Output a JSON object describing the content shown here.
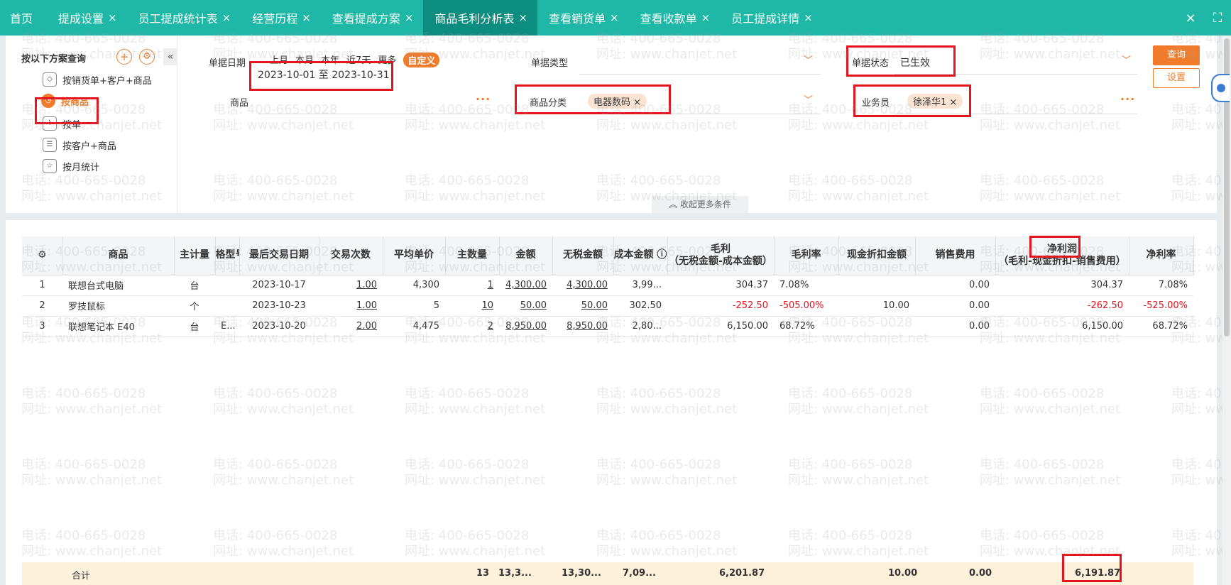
{
  "tabs": [
    {
      "label": "首页",
      "closable": false,
      "active": false
    },
    {
      "label": "提成设置",
      "closable": true,
      "active": false
    },
    {
      "label": "员工提成统计表",
      "closable": true,
      "active": false
    },
    {
      "label": "经营历程",
      "closable": true,
      "active": false
    },
    {
      "label": "查看提成方案",
      "closable": true,
      "active": false
    },
    {
      "label": "商品毛利分析表",
      "closable": true,
      "active": true
    },
    {
      "label": "查看销货单",
      "closable": true,
      "active": false
    },
    {
      "label": "查看收款单",
      "closable": true,
      "active": false
    },
    {
      "label": "员工提成详情",
      "closable": true,
      "active": false
    }
  ],
  "tabbar_icons": {
    "close_all": "×",
    "fullscreen": "⛶"
  },
  "close_glyph": "×",
  "scheme": {
    "title": "按以下方案查询",
    "add": "+",
    "settings": "⚙",
    "collapse": "«",
    "items": [
      {
        "label": "按销货单+客户+商品",
        "icon": "cube-icon",
        "glyph": "◇",
        "active": false
      },
      {
        "label": "按商品",
        "icon": "clock-icon",
        "glyph": "◔",
        "active": true
      },
      {
        "label": "按单",
        "icon": "chart-icon",
        "glyph": "⌇",
        "active": false
      },
      {
        "label": "按客户+商品",
        "icon": "contact-icon",
        "glyph": "☰",
        "active": false
      },
      {
        "label": "按月统计",
        "icon": "calendar-icon",
        "glyph": "☆",
        "active": false
      }
    ]
  },
  "filters": {
    "date_label": "单据日期",
    "quick_ranges": [
      "上月",
      "本月",
      "本年",
      "近7天",
      "更多"
    ],
    "custom_label": "自定义",
    "date_range": "2023-10-01 至 2023-10-31",
    "type_label": "单据类型",
    "status_label": "单据状态",
    "status_value": "已生效",
    "product_label": "商品",
    "category_label": "商品分类",
    "category_tag": "电器数码",
    "salesman_label": "业务员",
    "salesman_tag": "徐泽华1",
    "more_glyph": "···",
    "chevron": "﹀",
    "more_conditions": "收起更多条件"
  },
  "buttons": {
    "query": "查询",
    "settings": "设置"
  },
  "table": {
    "settings_glyph": "⚙",
    "headers": [
      {
        "l1": "",
        "l2": ""
      },
      {
        "l1": "商品",
        "l2": ""
      },
      {
        "l1": "主计量",
        "l2": ""
      },
      {
        "l1": "格型号",
        "l2": ""
      },
      {
        "l1": "最后交易日期",
        "l2": ""
      },
      {
        "l1": "交易次数",
        "l2": ""
      },
      {
        "l1": "平均单价",
        "l2": ""
      },
      {
        "l1": "主数量",
        "l2": ""
      },
      {
        "l1": "金额",
        "l2": ""
      },
      {
        "l1": "无税金额",
        "l2": ""
      },
      {
        "l1": "成本金额 ⓘ",
        "l2": ""
      },
      {
        "l1": "毛利",
        "l2": "（无税金额-成本金额）"
      },
      {
        "l1": "毛利率",
        "l2": ""
      },
      {
        "l1": "现金折扣金额",
        "l2": ""
      },
      {
        "l1": "销售费用",
        "l2": ""
      },
      {
        "l1": "净利润",
        "l2": "（毛利-现金折扣-销售费用）"
      },
      {
        "l1": "净利率",
        "l2": ""
      }
    ],
    "rows": [
      [
        "1",
        "联想台式电脑",
        "台",
        "",
        "2023-10-17",
        "1.00",
        "4,300",
        "1",
        "4,300.00",
        "4,300.00",
        "3,99...",
        "304.37",
        "7.08%",
        "",
        "0.00",
        "304.37",
        "7.08%"
      ],
      [
        "2",
        "罗技鼠标",
        "个",
        "",
        "2023-10-23",
        "1.00",
        "5",
        "10",
        "50.00",
        "50.00",
        "302.50",
        "-252.50",
        "-505.00%",
        "10.00",
        "0.00",
        "-262.50",
        "-525.00%"
      ],
      [
        "3",
        "联想笔记本 E40",
        "台",
        "E...",
        "2023-10-20",
        "2.00",
        "4,475",
        "2",
        "8,950.00",
        "8,950.00",
        "2,80...",
        "6,150.00",
        "68.72%",
        "",
        "0.00",
        "6,150.00",
        "68.72%"
      ]
    ],
    "totals": {
      "label": "合计",
      "qty": "13",
      "amount": "13,3...",
      "net_amount": "13,30...",
      "cost": "7,09...",
      "gross": "6,201.87",
      "discount": "10.00",
      "fee": "0.00",
      "net_profit": "6,191.87"
    }
  },
  "watermark": {
    "line1": "电话: 400-665-0028",
    "line2": "网址: www.chanjet.net"
  },
  "colors": {
    "tab_bg": "#1fb7a6",
    "tab_active": "#0d8c80",
    "accent": "#f07c2b",
    "negative": "#e3141d",
    "highlight_box": "#e3141d"
  }
}
